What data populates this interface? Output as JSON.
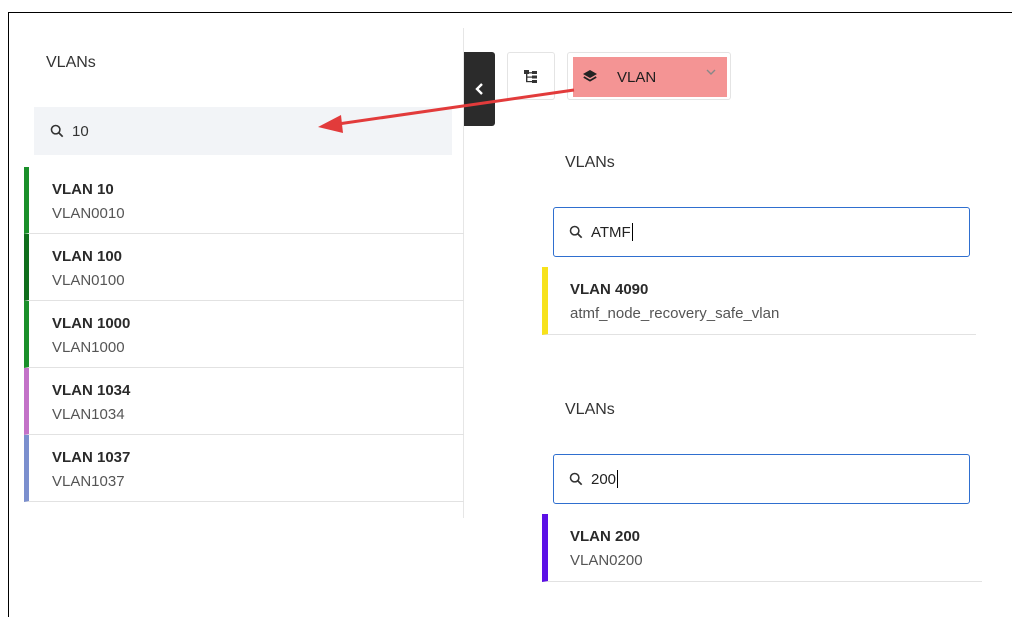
{
  "left_panel": {
    "title": "VLANs",
    "search": {
      "value": "10",
      "icon": "search-icon"
    },
    "items": [
      {
        "name": "VLAN 10",
        "code": "VLAN0010",
        "color": "#1a8f2a"
      },
      {
        "name": "VLAN 100",
        "code": "VLAN0100",
        "color": "#0f6e1c"
      },
      {
        "name": "VLAN 1000",
        "code": "VLAN1000",
        "color": "#1a8f2a"
      },
      {
        "name": "VLAN 1034",
        "code": "VLAN1034",
        "color": "#c372c8"
      },
      {
        "name": "VLAN 1037",
        "code": "VLAN1037",
        "color": "#7b8fce"
      }
    ]
  },
  "toolbar": {
    "collapse_icon": "chevron-left-icon",
    "tree_icon": "hierarchy-icon",
    "layer_icon": "layers-icon",
    "vlan_label": "VLAN",
    "dropdown_icon": "chevron-down-icon",
    "highlight_color": "#f49494"
  },
  "right_sections": [
    {
      "title": "VLANs",
      "search": {
        "value": "ATMF"
      },
      "items": [
        {
          "name": "VLAN 4090",
          "code": "atmf_node_recovery_safe_vlan",
          "color": "#f7e21b"
        }
      ]
    },
    {
      "title": "VLANs",
      "search": {
        "value": "200"
      },
      "items": [
        {
          "name": "VLAN 200",
          "code": "VLAN0200",
          "color": "#5b0fe6"
        }
      ]
    }
  ],
  "annotation": {
    "arrow_color": "#e23b3b"
  }
}
